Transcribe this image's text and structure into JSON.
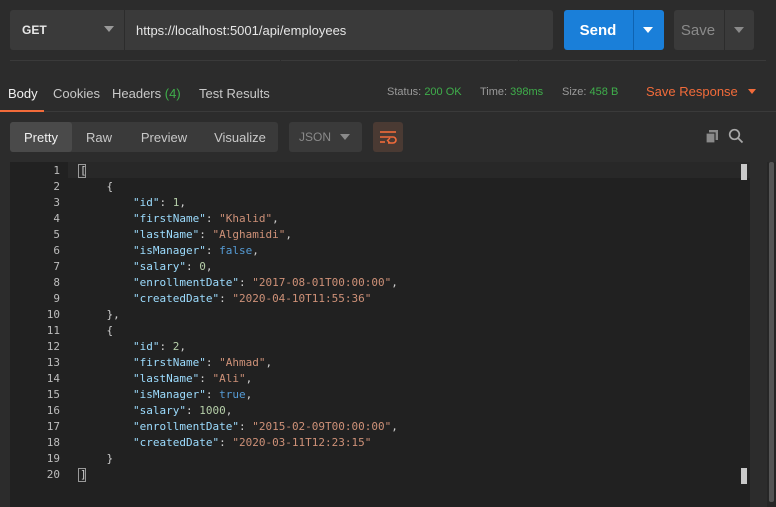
{
  "request": {
    "method": "GET",
    "url": "https://localhost:5001/api/employees",
    "send_label": "Send",
    "save_label": "Save"
  },
  "response_tabs": [
    {
      "label": "Body",
      "active": true
    },
    {
      "label": "Cookies"
    },
    {
      "label": "Headers",
      "count": "(4)"
    },
    {
      "label": "Test Results"
    }
  ],
  "status": {
    "status_label": "Status:",
    "status_value": "200 OK",
    "time_label": "Time:",
    "time_value": "398ms",
    "size_label": "Size:",
    "size_value": "458 B"
  },
  "save_response_label": "Save Response",
  "format_tabs": [
    "Pretty",
    "Raw",
    "Preview",
    "Visualize"
  ],
  "format_selected": "JSON",
  "icons": {
    "wrap": "wrap-lines-icon",
    "copy": "copy-icon",
    "search": "search-icon"
  },
  "colors": {
    "accent": "#f26b3a",
    "send": "#1a7fd9",
    "status_ok": "#3fae4b"
  },
  "code_lines": [
    {
      "n": "1",
      "t": "["
    },
    {
      "n": "2",
      "t": "    {"
    },
    {
      "n": "3",
      "t": "        \"id\": 1,"
    },
    {
      "n": "4",
      "t": "        \"firstName\": \"Khalid\","
    },
    {
      "n": "5",
      "t": "        \"lastName\": \"Alghamidi\","
    },
    {
      "n": "6",
      "t": "        \"isManager\": false,"
    },
    {
      "n": "7",
      "t": "        \"salary\": 0,"
    },
    {
      "n": "8",
      "t": "        \"enrollmentDate\": \"2017-08-01T00:00:00\","
    },
    {
      "n": "9",
      "t": "        \"createdDate\": \"2020-04-10T11:55:36\""
    },
    {
      "n": "10",
      "t": "    },"
    },
    {
      "n": "11",
      "t": "    {"
    },
    {
      "n": "12",
      "t": "        \"id\": 2,"
    },
    {
      "n": "13",
      "t": "        \"firstName\": \"Ahmad\","
    },
    {
      "n": "14",
      "t": "        \"lastName\": \"Ali\","
    },
    {
      "n": "15",
      "t": "        \"isManager\": true,"
    },
    {
      "n": "16",
      "t": "        \"salary\": 1000,"
    },
    {
      "n": "17",
      "t": "        \"enrollmentDate\": \"2015-02-09T00:00:00\","
    },
    {
      "n": "18",
      "t": "        \"createdDate\": \"2020-03-11T12:23:15\""
    },
    {
      "n": "19",
      "t": "    }"
    },
    {
      "n": "20",
      "t": "]"
    }
  ]
}
